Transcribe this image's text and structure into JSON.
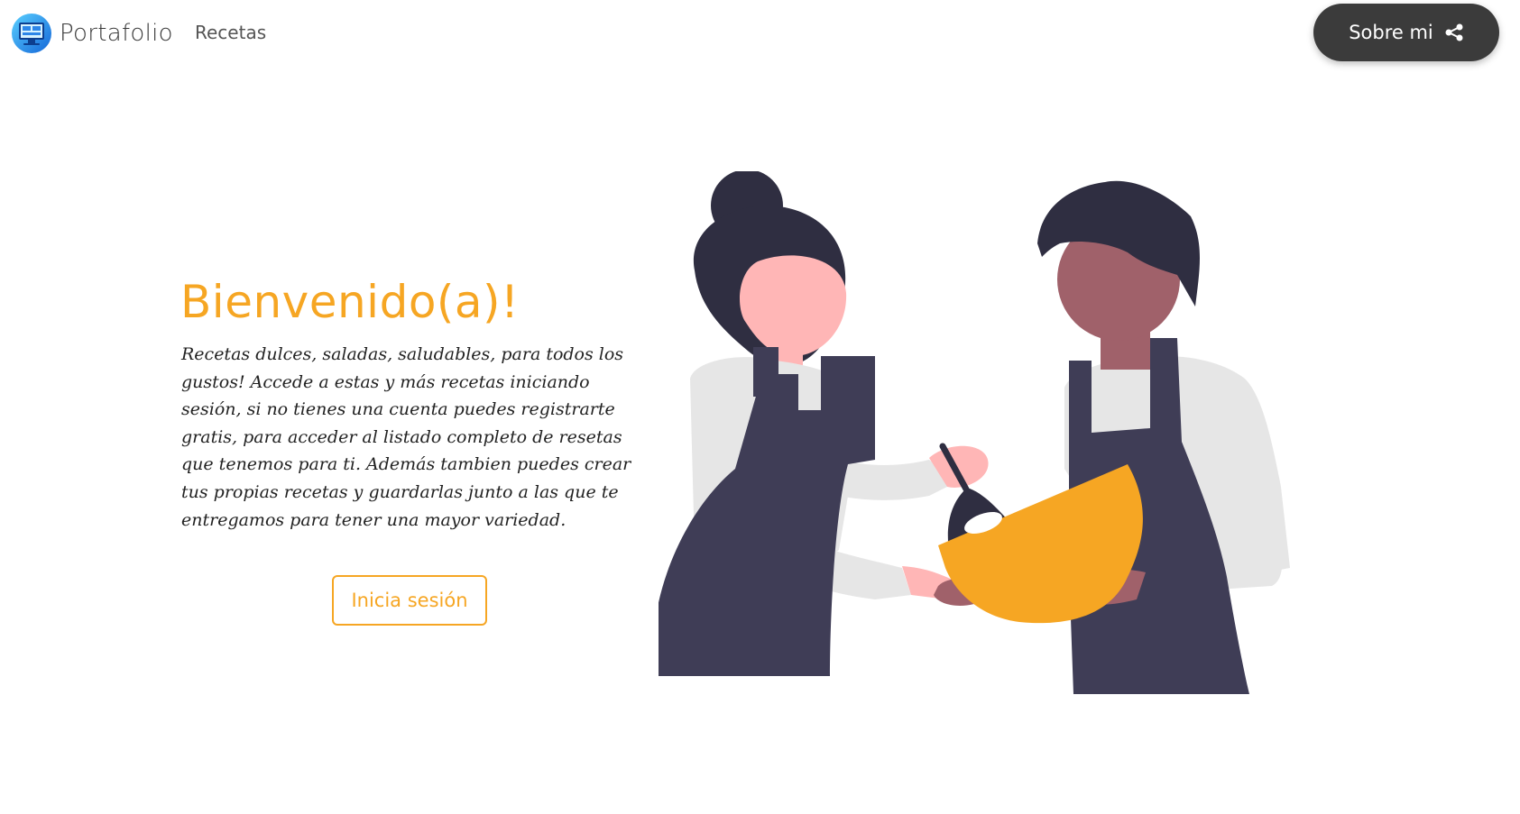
{
  "navbar": {
    "brand_label": "Portafolio",
    "brand_icon": "monitor-logo-icon",
    "links": [
      {
        "label": "Recetas"
      }
    ],
    "about_button_label": "Sobre mi",
    "about_button_icon": "share-icon"
  },
  "hero": {
    "title": "Bienvenido(a)!",
    "description": "Recetas dulces, saladas, saludables, para todos los gustos! Accede a estas y más recetas iniciando sesión, si no tienes una cuenta puedes registrarte gratis, para acceder al listado completo de resetas que tenemos para ti. Además tambien puedes crear tus propias recetas y guardarlas junto a las que te entregamos para tener una mayor variedad.",
    "login_button_label": "Inicia sesión"
  },
  "illustration": {
    "name": "two-cooks-mixing-bowl-illustration"
  },
  "colors": {
    "accent": "#f6a623",
    "dark_button": "#3b3b3b",
    "apron": "#3f3d56",
    "hair": "#2f2e41",
    "skin_light": "#ffb6b6",
    "skin_dark": "#a0616a",
    "shirt": "#e6e6e6"
  }
}
